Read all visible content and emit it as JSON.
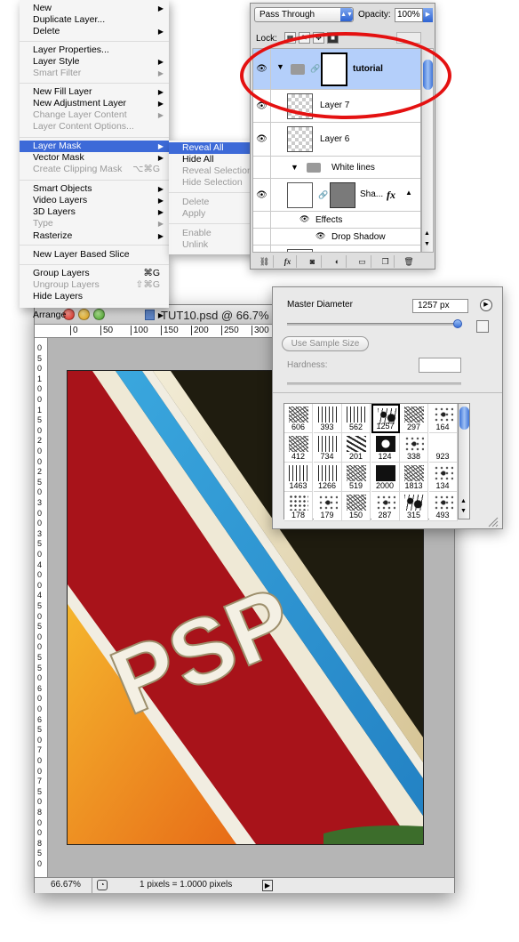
{
  "context_menu": {
    "items": [
      {
        "label": "New",
        "arrow": true
      },
      {
        "label": "Duplicate Layer...",
        "arrow": false
      },
      {
        "label": "Delete",
        "arrow": true
      },
      {
        "label": "Layer Properties...",
        "arrow": false
      },
      {
        "label": "Layer Style",
        "arrow": true
      },
      {
        "label": "Smart Filter",
        "arrow": true,
        "disabled": true
      },
      {
        "label": "New Fill Layer",
        "arrow": true
      },
      {
        "label": "New Adjustment Layer",
        "arrow": true
      },
      {
        "label": "Change Layer Content",
        "arrow": true,
        "disabled": true
      },
      {
        "label": "Layer Content Options...",
        "disabled": true
      },
      {
        "label": "Layer Mask",
        "arrow": true,
        "highlighted": true
      },
      {
        "label": "Vector Mask",
        "arrow": true
      },
      {
        "label": "Create Clipping Mask",
        "shortcut": "⌥⌘G",
        "disabled": true
      },
      {
        "label": "Smart Objects",
        "arrow": true
      },
      {
        "label": "Video Layers",
        "arrow": true
      },
      {
        "label": "3D Layers",
        "arrow": true
      },
      {
        "label": "Type",
        "arrow": true,
        "disabled": true
      },
      {
        "label": "Rasterize",
        "arrow": true
      },
      {
        "label": "New Layer Based Slice"
      },
      {
        "label": "Group Layers",
        "shortcut": "⌘G"
      },
      {
        "label": "Ungroup Layers",
        "shortcut": "⇧⌘G",
        "disabled": true
      },
      {
        "label": "Hide Layers"
      },
      {
        "label": "Arrange",
        "arrow": true
      }
    ]
  },
  "submenu": {
    "items": [
      {
        "label": "Reveal All",
        "highlighted": true
      },
      {
        "label": "Hide All"
      },
      {
        "label": "Reveal Selection",
        "disabled": true
      },
      {
        "label": "Hide Selection",
        "disabled": true
      },
      {
        "label": "Delete",
        "disabled": true
      },
      {
        "label": "Apply",
        "disabled": true
      },
      {
        "label": "Enable",
        "disabled": true
      },
      {
        "label": "Unlink",
        "disabled": true
      }
    ]
  },
  "layers_panel": {
    "blend_mode": "Pass Through",
    "opacity_label": "Opacity:",
    "opacity_value": "100%",
    "lock_label": "Lock:",
    "layers": {
      "tutorial": "tutorial",
      "layer7": "Layer 7",
      "layer6": "Layer 6",
      "group_white_lines": "White lines",
      "shape_layer": "Sha...",
      "fx_badge": "fx",
      "effects": "Effects",
      "drop_shadow": "Drop Shadow"
    },
    "footer_buttons": [
      "link-icon",
      "fx-icon",
      "mask-icon",
      "adjustment-icon",
      "folder-icon",
      "new-layer-icon",
      "trash-icon"
    ]
  },
  "document": {
    "title": "TUT10.psd @ 66.7%",
    "ruler_top_ticks": [
      "0",
      "50",
      "100",
      "150",
      "200",
      "250",
      "300"
    ],
    "ruler_left_ticks": [
      "0",
      "5",
      "0",
      "1",
      "0",
      "0",
      "1",
      "5",
      "0",
      "2",
      "0",
      "0",
      "2",
      "5",
      "0",
      "3",
      "0",
      "0",
      "3",
      "5",
      "0",
      "4",
      "0",
      "0",
      "4",
      "5",
      "0",
      "5",
      "0",
      "0",
      "5",
      "5",
      "0",
      "6",
      "0",
      "0",
      "6",
      "5",
      "0",
      "7",
      "0",
      "0",
      "7",
      "5",
      "0",
      "8",
      "0",
      "0",
      "8",
      "5",
      "0"
    ],
    "zoom": "66.67%",
    "status_info": "1 pixels = 1.0000 pixels",
    "artwork_text": "PSP",
    "colors": {
      "background": "#1e1b0e",
      "red": "#a8131a",
      "blue": "#2e9ad6",
      "orange": "#f3a028",
      "cream": "#e5dcc0"
    }
  },
  "brush_panel": {
    "master_diameter_label": "Master Diameter",
    "master_diameter_value": "1257 px",
    "sample_size_label": "Use Sample Size",
    "hardness_label": "Hardness:",
    "brushes": [
      "606",
      "393",
      "562",
      "1257",
      "297",
      "164",
      "412",
      "734",
      "201",
      "124",
      "338",
      "923",
      "1463",
      "1266",
      "519",
      "2000",
      "1813",
      "134",
      "178",
      "179",
      "150",
      "287",
      "315",
      "493"
    ],
    "selected_brush": "1257"
  }
}
